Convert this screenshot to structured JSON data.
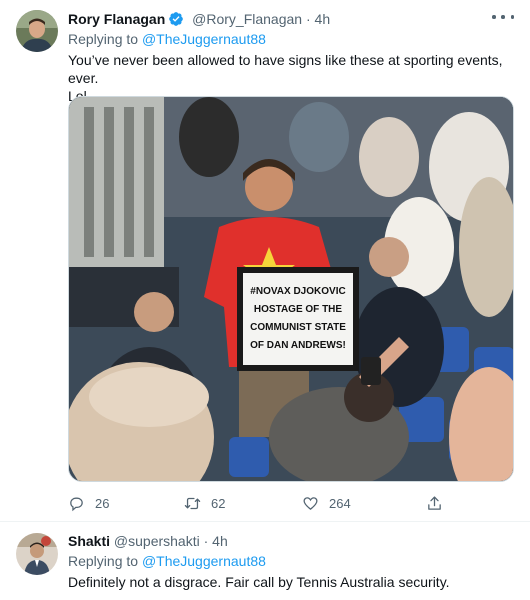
{
  "tweets": [
    {
      "display_name": "Rory Flanagan",
      "verified": true,
      "handle": "@Rory_Flanagan",
      "separator": "·",
      "time": "4h",
      "reply_prefix": "Replying to",
      "reply_to": "@TheJuggernaut88",
      "text_line1": "You’ve never been allowed to have signs like these at sporting events, ever.",
      "text_line2": "Lol.",
      "media": {
        "sign_lines": [
          "#NOVAX DJOKOVIC",
          "HOSTAGE OF THE",
          "COMMUNIST STATE",
          "OF DAN ANDREWS!"
        ]
      },
      "stats": {
        "replies": "26",
        "retweets": "62",
        "likes": "264"
      },
      "icons": [
        "reply-icon",
        "retweet-icon",
        "like-icon",
        "share-icon"
      ]
    },
    {
      "display_name": "Shakti",
      "handle": "@supershakti",
      "separator": "·",
      "time": "4h",
      "reply_prefix": "Replying to",
      "reply_to": "@TheJuggernaut88",
      "text_line1": "Definitely not a disgrace. Fair call by Tennis Australia security."
    }
  ],
  "colors": {
    "accent": "#1d9bf0",
    "muted": "#536471",
    "text": "#0f1419",
    "divider": "#eff3f4"
  }
}
